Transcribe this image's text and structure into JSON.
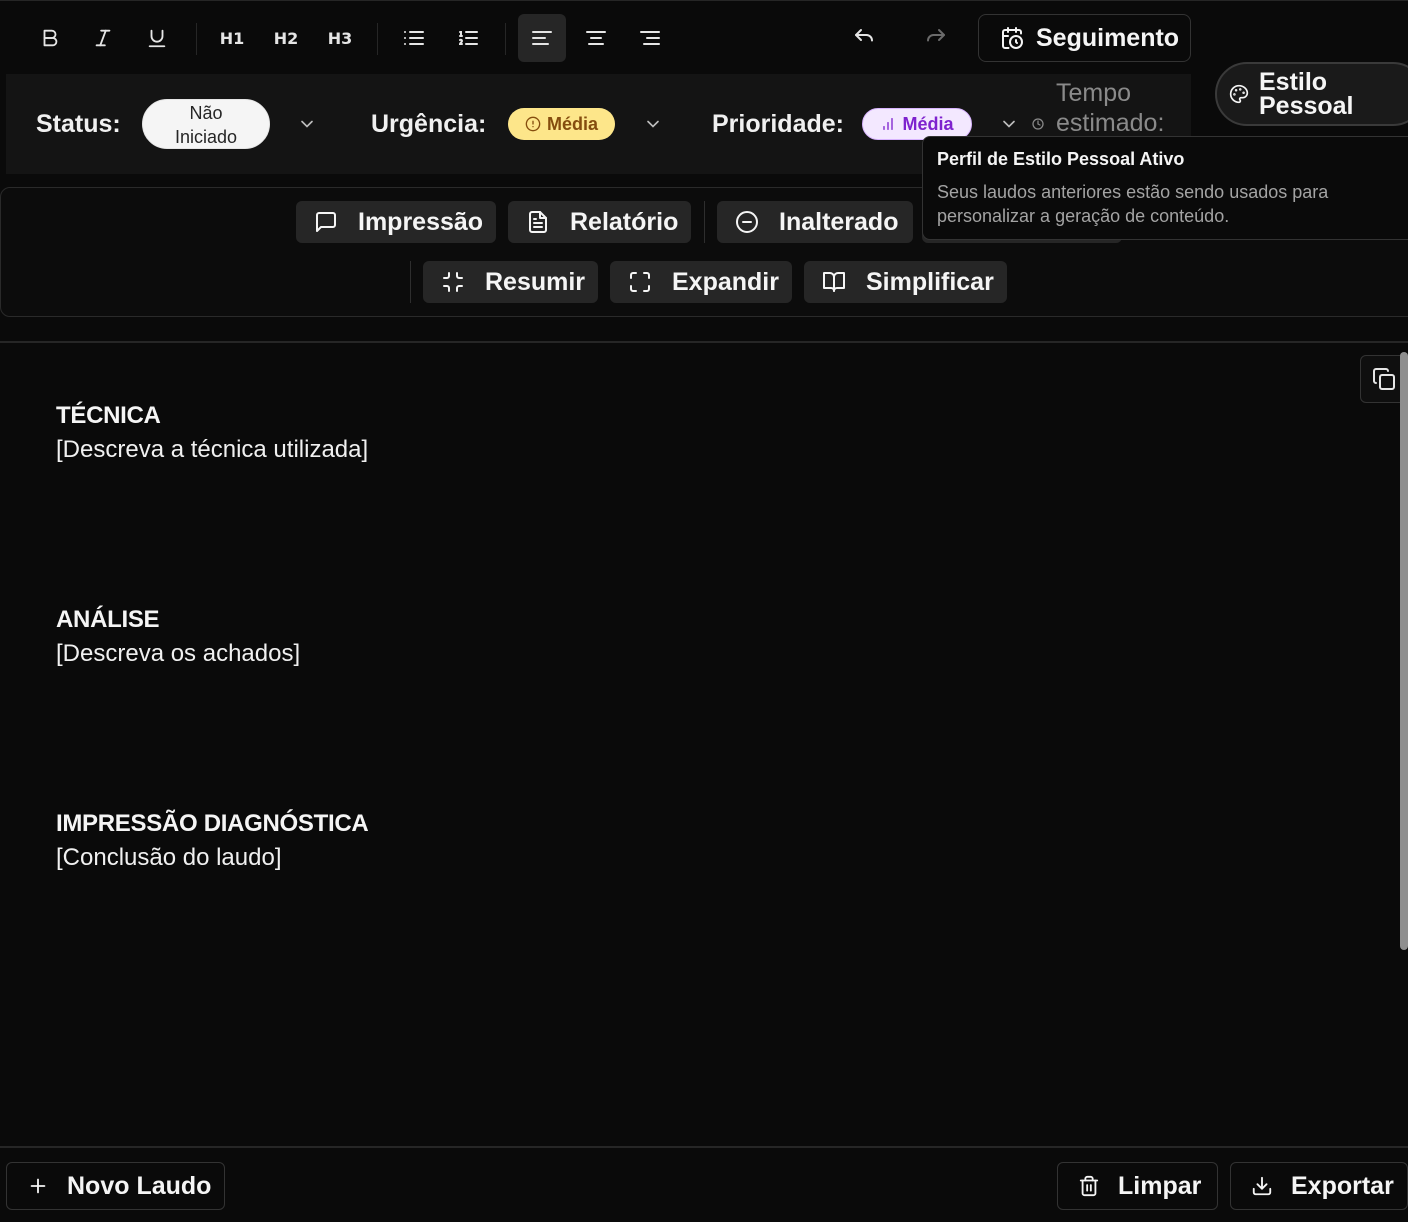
{
  "toolbar": {
    "heading1": "H1",
    "heading2": "H2",
    "heading3": "H3",
    "followup_label": "Seguimento"
  },
  "status_bar": {
    "status_label": "Status:",
    "status_value_line1": "Não",
    "status_value_line2": "Iniciado",
    "urgency_label": "Urgência:",
    "urgency_value": "Média",
    "priority_label": "Prioridade:",
    "priority_value": "Média",
    "estimated_line1": "Tempo",
    "estimated_line2": "estimado:",
    "style_line1": "Estilo",
    "style_line2": "Pessoal"
  },
  "tooltip": {
    "title": "Perfil de Estilo Pessoal Ativo",
    "text_line1": "Seus laudos anteriores estão sendo usados para",
    "text_line2": "personalizar a geração de conteúdo."
  },
  "actions": {
    "impressao": "Impressão",
    "relatorio": "Relatório",
    "inalterado": "Inalterado",
    "resumir": "Resumir",
    "expandir": "Expandir",
    "simplificar": "Simplificar"
  },
  "editor": {
    "sections": [
      {
        "title": "TÉCNICA",
        "body": "[Descreva a técnica utilizada]"
      },
      {
        "title": "ANÁLISE",
        "body": "[Descreva os achados]"
      },
      {
        "title": "IMPRESSÃO DIAGNÓSTICA",
        "body": "[Conclusão do laudo]"
      }
    ]
  },
  "footer": {
    "new_report": "Novo Laudo",
    "clear": "Limpar",
    "export": "Exportar"
  },
  "colors": {
    "background": "#0a0a0a",
    "urgency_pill": "#fde68a",
    "priority_pill": "#f3e8ff",
    "status_pill": "#f5f5f5"
  }
}
